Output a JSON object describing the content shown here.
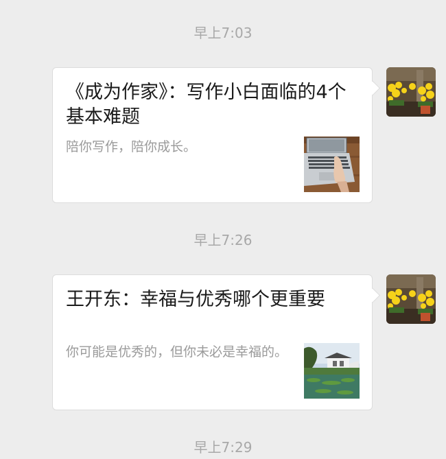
{
  "messages": [
    {
      "time": "早上7:03",
      "title": "《成为作家》：写作小白面临的4个基本难题",
      "description": "陪你写作，陪你成长。",
      "thumbnail_icon": "laptop-typing-photo"
    },
    {
      "time": "早上7:26",
      "title": "王开东：幸福与优秀哪个更重要",
      "description": "你可能是优秀的，但你未必是幸福的。",
      "thumbnail_icon": "garden-pavilion-photo"
    }
  ],
  "trailing_time": "早上7:29",
  "avatar_icon": "yellow-flowers-avatar",
  "colors": {
    "background": "#ededed",
    "bubble": "#ffffff",
    "timestamp": "#a8a8a8",
    "title": "#1a1a1a",
    "description": "#9a9a9a"
  }
}
